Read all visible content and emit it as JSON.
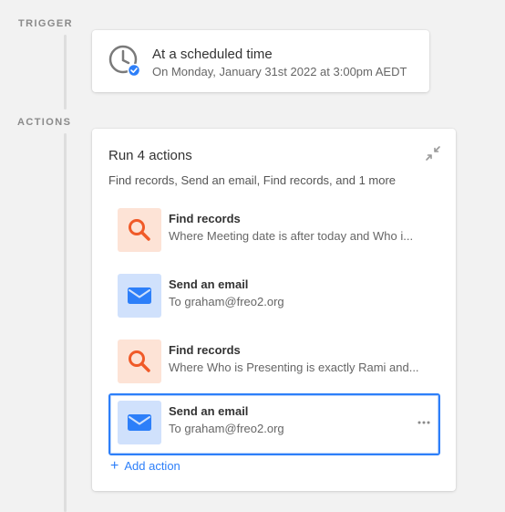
{
  "trigger": {
    "label": "TRIGGER",
    "title": "At a scheduled time",
    "subtitle": "On Monday, January 31st 2022 at 3:00pm AEDT",
    "icon": "clock-check-icon"
  },
  "actions": {
    "label": "ACTIONS",
    "title": "Run 4 actions",
    "summary": "Find records, Send an email, Find records, and 1 more",
    "collapse_icon": "collapse-arrows-icon",
    "steps": [
      {
        "title": "Find records",
        "description": "Where Meeting date is after today and Who i...",
        "icon": "search-icon",
        "icon_color": "#f05a28",
        "icon_bg": "#fde3d6"
      },
      {
        "title": "Send an email",
        "description": "To graham@freo2.org",
        "icon": "envelope-icon",
        "icon_color": "#2d7ff9",
        "icon_bg": "#d0e1fc"
      },
      {
        "title": "Find records",
        "description": "Where Who is Presenting is exactly Rami and...",
        "icon": "search-icon",
        "icon_color": "#f05a28",
        "icon_bg": "#fde3d6"
      },
      {
        "title": "Send an email",
        "description": "To graham@freo2.org",
        "icon": "envelope-icon",
        "icon_color": "#2d7ff9",
        "icon_bg": "#d0e1fc",
        "selected": true
      }
    ],
    "add_action_label": "Add action",
    "add_action_glyph": "+"
  },
  "colors": {
    "accent": "#2d7ff9",
    "background": "#f2f2f2"
  }
}
